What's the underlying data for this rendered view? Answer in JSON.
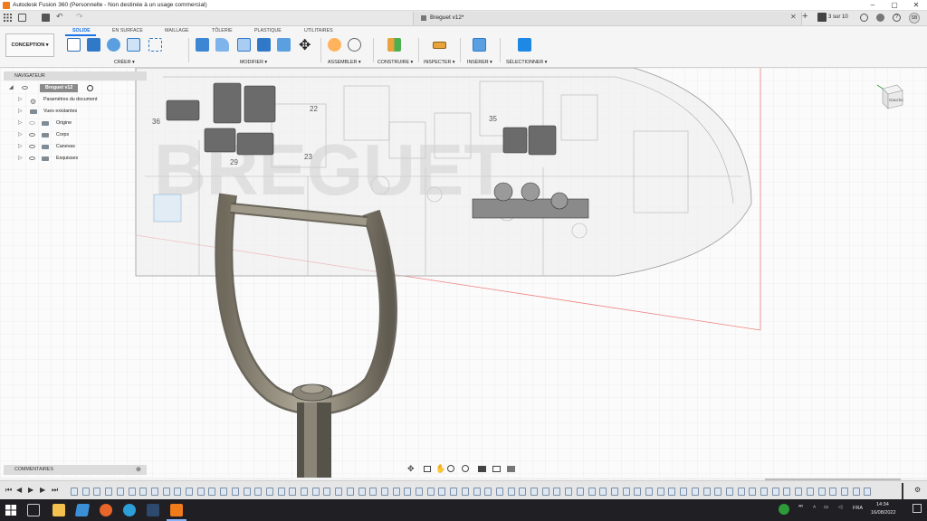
{
  "app": {
    "title": "Autodesk Fusion 360 (Personnelle - Non destinée à un usage commercial)",
    "document_tab": "Breguet v12*",
    "jobs": "3 sur 10",
    "user_initials": "SB",
    "brand_color": "#f07b1b",
    "accent_color": "#1a73e8"
  },
  "window_controls": {
    "minimize": "–",
    "maximize": "▢",
    "close": "✕"
  },
  "workspace": {
    "label": "CONCEPTION ▾"
  },
  "tabs": [
    {
      "label": "SOLIDE",
      "active": true
    },
    {
      "label": "EN SURFACE",
      "active": false
    },
    {
      "label": "MAILLAGE",
      "active": false
    },
    {
      "label": "TÔLERIE",
      "active": false
    },
    {
      "label": "PLASTIQUE",
      "active": false
    },
    {
      "label": "UTILITAIRES",
      "active": false
    }
  ],
  "groups": [
    {
      "label": "CRÉER ▾"
    },
    {
      "label": "MODIFIER ▾"
    },
    {
      "label": "ASSEMBLER ▾"
    },
    {
      "label": "CONSTRUIRE ▾"
    },
    {
      "label": "INSPECTER ▾"
    },
    {
      "label": "INSÉRER ▾"
    },
    {
      "label": "SÉLECTIONNER ▾"
    }
  ],
  "navigator": {
    "header": "NAVIGATEUR",
    "root": "Breguet v12",
    "items": [
      {
        "label": "Paramètres du document",
        "icon": "gear-icon"
      },
      {
        "label": "Vues existantes",
        "icon": "folder-icon"
      },
      {
        "label": "Origine",
        "icon": "folder-icon"
      },
      {
        "label": "Corps",
        "icon": "folder-icon"
      },
      {
        "label": "Canevas",
        "icon": "folder-icon"
      },
      {
        "label": "Esquisses",
        "icon": "folder-icon"
      }
    ]
  },
  "canvas_labels": [
    "36",
    "29",
    "22",
    "23",
    "35"
  ],
  "viewcube": {
    "label": "Gauche"
  },
  "comments": {
    "label": "COMMENTAIRES"
  },
  "taskbar": {
    "language": "FRA",
    "time": "14:34",
    "date": "16/08/2022"
  }
}
